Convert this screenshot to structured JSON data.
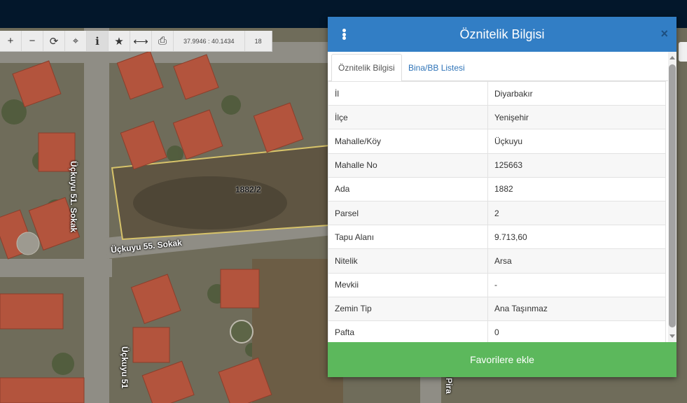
{
  "toolbar": {
    "buttons": [
      {
        "name": "zoom-in",
        "glyph": "+"
      },
      {
        "name": "zoom-out",
        "glyph": "−"
      },
      {
        "name": "refresh",
        "glyph": "⟳"
      },
      {
        "name": "locate",
        "glyph": "⌖"
      },
      {
        "name": "info",
        "glyph": "i"
      },
      {
        "name": "favorites",
        "glyph": "★"
      },
      {
        "name": "measure",
        "glyph": "⟷"
      },
      {
        "name": "print",
        "glyph": "⎙"
      }
    ],
    "coordinates": "37.9946 : 40.1434",
    "zoom": "18"
  },
  "map": {
    "parcel_label": "1882/2",
    "street_1": "Üçkuyu 51. Sokak",
    "street_2": "Üçkuyu 55. Sokak",
    "street_3": "Üçkuyu 51",
    "street_4": "Pira"
  },
  "panel": {
    "title": "Öznitelik Bilgisi",
    "close": "×",
    "tabs": [
      "Öznitelik Bilgisi",
      "Bina/BB Listesi"
    ],
    "rows": [
      {
        "key": "İl",
        "value": "Diyarbakır"
      },
      {
        "key": "İlçe",
        "value": "Yenişehir"
      },
      {
        "key": "Mahalle/Köy",
        "value": "Üçkuyu"
      },
      {
        "key": "Mahalle No",
        "value": "125663"
      },
      {
        "key": "Ada",
        "value": "1882"
      },
      {
        "key": "Parsel",
        "value": "2"
      },
      {
        "key": "Tapu Alanı",
        "value": "9.713,60"
      },
      {
        "key": "Nitelik",
        "value": "Arsa"
      },
      {
        "key": "Mevkii",
        "value": "-"
      },
      {
        "key": "Zemin Tip",
        "value": "Ana Taşınmaz"
      },
      {
        "key": "Pafta",
        "value": "0"
      }
    ],
    "button": "Favorilere ekle"
  },
  "colors": {
    "header": "#327ec5",
    "button": "#5cb85c",
    "topbar": "#03172b"
  }
}
